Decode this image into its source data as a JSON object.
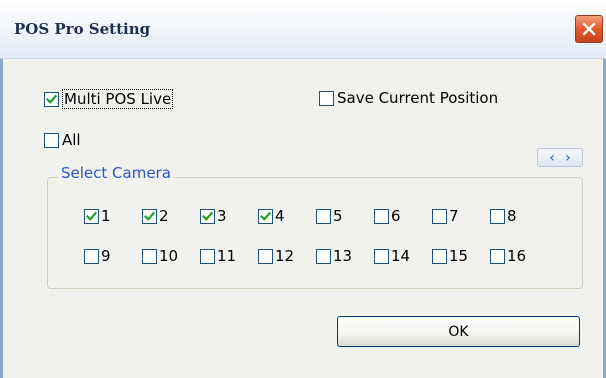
{
  "window": {
    "title": "POS Pro Setting"
  },
  "options": {
    "multi_pos_live": {
      "label": "Multi POS Live",
      "checked": true
    },
    "save_current_position": {
      "label": "Save Current Position",
      "checked": false
    },
    "all": {
      "label": "All",
      "checked": false
    }
  },
  "select_camera": {
    "title": "Select Camera",
    "scroll_left": "‹",
    "scroll_right": "›",
    "cameras": [
      {
        "label": "1",
        "checked": true
      },
      {
        "label": "2",
        "checked": true
      },
      {
        "label": "3",
        "checked": true
      },
      {
        "label": "4",
        "checked": true
      },
      {
        "label": "5",
        "checked": false
      },
      {
        "label": "6",
        "checked": false
      },
      {
        "label": "7",
        "checked": false
      },
      {
        "label": "8",
        "checked": false
      },
      {
        "label": "9",
        "checked": false
      },
      {
        "label": "10",
        "checked": false
      },
      {
        "label": "11",
        "checked": false
      },
      {
        "label": "12",
        "checked": false
      },
      {
        "label": "13",
        "checked": false
      },
      {
        "label": "14",
        "checked": false
      },
      {
        "label": "15",
        "checked": false
      },
      {
        "label": "16",
        "checked": false
      }
    ]
  },
  "buttons": {
    "ok": "OK"
  },
  "colors": {
    "check_mark": "#21a121",
    "group_title": "#2a55c9",
    "close_button": "#e2552a"
  }
}
